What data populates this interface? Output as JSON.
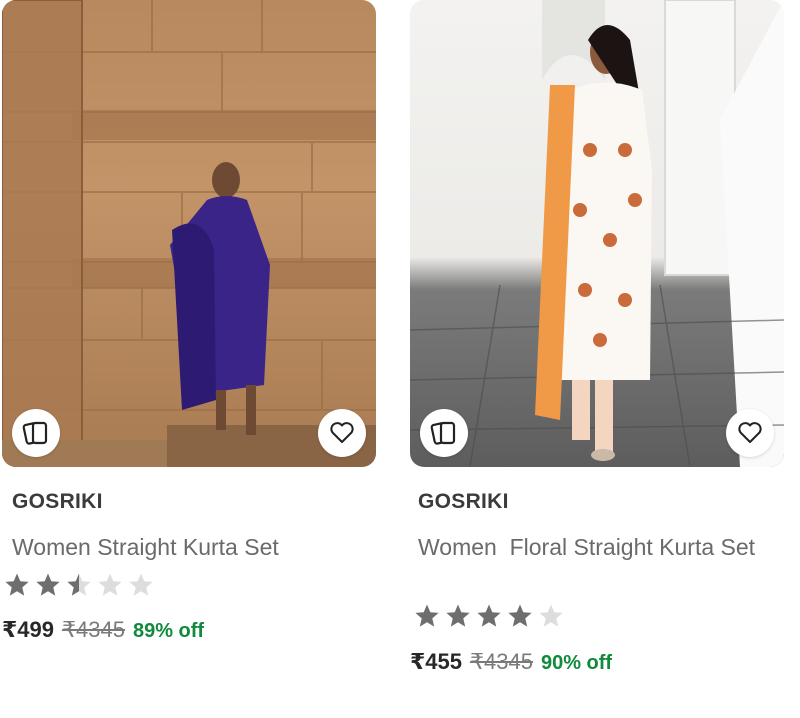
{
  "products": [
    {
      "brand": "GOSRIKI",
      "title": "Women Straight Kurta Set",
      "rating": 2.5,
      "rating_max": 5,
      "price": "₹499",
      "mrp": "₹4345",
      "discount": "89% off",
      "left_icon": "similar-products-icon",
      "right_icon": "heart-icon"
    },
    {
      "brand": "GOSRIKI",
      "title": "Women  Floral Straight Kurta Set",
      "rating": 4,
      "rating_max": 5,
      "price": "₹455",
      "mrp": "₹4345",
      "discount": "90% off",
      "left_icon": "similar-products-icon",
      "right_icon": "heart-icon"
    }
  ],
  "colors": {
    "discount": "#118a3d",
    "star_filled": "#6e6e6e",
    "star_empty": "#dddddd"
  }
}
